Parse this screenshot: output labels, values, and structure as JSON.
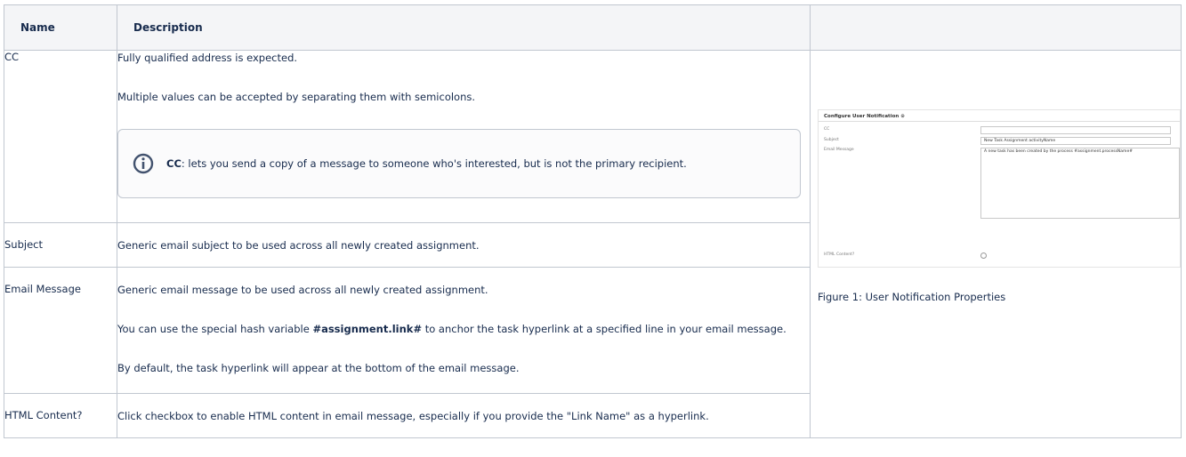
{
  "header": {
    "name": "Name",
    "description": "Description"
  },
  "rows": [
    {
      "name": "CC",
      "paragraphs": [
        "Fully qualified address is expected.",
        "Multiple values can be accepted by separating them with semicolons."
      ],
      "note": {
        "strong": "CC",
        "text": ": lets you send a copy of a message to someone who's interested, but is not the primary recipient."
      }
    },
    {
      "name": "Subject",
      "paragraphs": [
        "Generic email subject to be used across all newly created assignment."
      ]
    },
    {
      "name": "Email Message",
      "paragraphs": [
        "Generic email message to be used across all newly created assignment.",
        "By default, the task hyperlink will appear at the bottom of the email message."
      ],
      "hash_para": {
        "before": "You can use the special hash variable ",
        "variable": "#assignment.link#",
        "after": " to anchor the task hyperlink at a specified line in your email message."
      }
    },
    {
      "name": "HTML Content?",
      "paragraphs": [
        "Click checkbox to enable HTML content in email message, especially if you provide the \"Link Name\" as a hyperlink."
      ]
    }
  ],
  "figure": {
    "title": "Configure User Notification",
    "labels": [
      "CC",
      "Subject",
      "Email Message",
      "HTML Content?"
    ],
    "subject_value": "New Task Assignment activityName",
    "message_value": "A new task has been created by the process #assignment.processName#",
    "caption": "Figure 1: User Notification Properties"
  },
  "icons": {
    "note": "info-icon"
  },
  "colors": {
    "border": "#c1c7d0",
    "header_bg": "#f4f5f7",
    "text": "#172b4d"
  }
}
